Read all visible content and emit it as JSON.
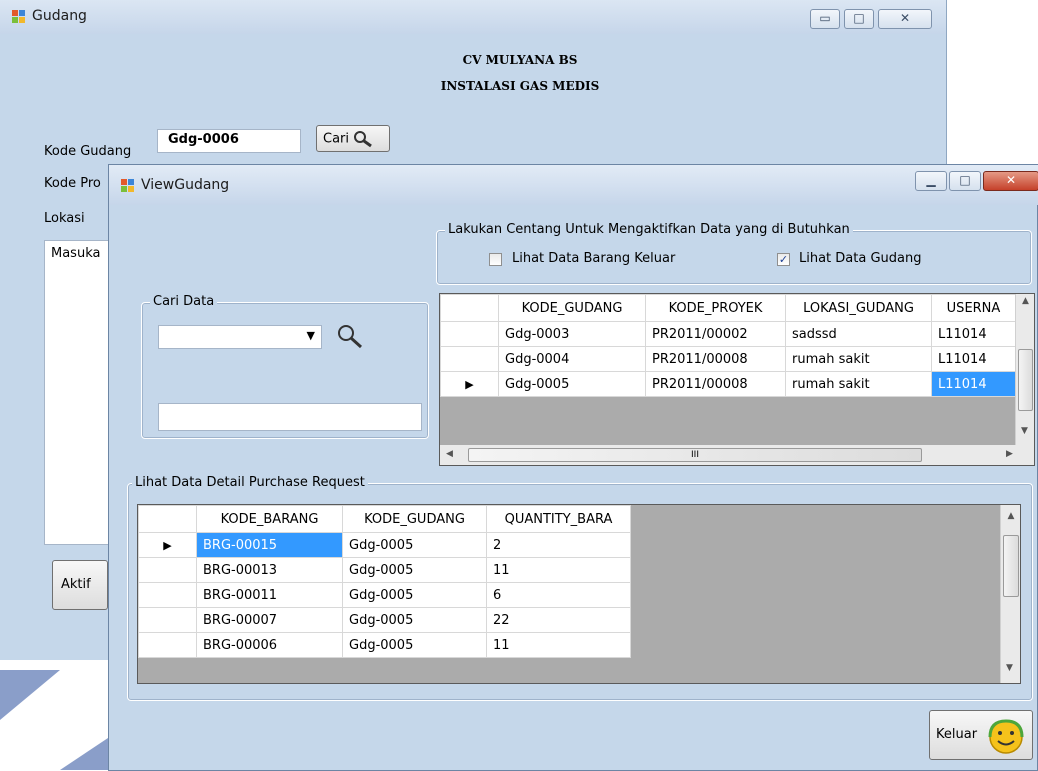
{
  "gudang_window": {
    "title": "Gudang",
    "company": "CV MULYANA BS",
    "subtitle": "INSTALASI GAS MEDIS",
    "kode_gudang_label": "Kode Gudang",
    "kode_gudang_value": "Gdg-0006",
    "cari_label": "Cari",
    "kode_proyek_label": "Kode Pro",
    "lokasi_label": "Lokasi",
    "lokasi_value": "Masuka",
    "aktif_label": "Aktif"
  },
  "view_window": {
    "title": "ViewGudang",
    "check_group_title": "Lakukan Centang Untuk Mengaktifkan Data yang di Butuhkan",
    "check_keluar_label": "Lihat Data Barang Keluar",
    "check_keluar_checked": false,
    "check_gudang_label": "Lihat Data Gudang",
    "check_gudang_checked": true,
    "cari_group_title": "Cari Data",
    "cari_text": "",
    "detail_group_title": "Lihat Data Detail Purchase Request",
    "keluar_label": "Keluar"
  },
  "gudang_grid": {
    "columns": [
      "KODE_GUDANG",
      "KODE_PROYEK",
      "LOKASI_GUDANG",
      "USERNA"
    ],
    "rows": [
      [
        "Gdg-0003",
        "PR2011/00002",
        "sadssd",
        "L11014"
      ],
      [
        "Gdg-0004",
        "PR2011/00008",
        "rumah sakit",
        "L11014"
      ],
      [
        "Gdg-0005",
        "PR2011/00008",
        "rumah sakit",
        "L11014"
      ]
    ],
    "current_row_marker": "▶",
    "hscroll_thumb_glyph": "III"
  },
  "detail_grid": {
    "columns": [
      "KODE_BARANG",
      "KODE_GUDANG",
      "QUANTITY_BARA"
    ],
    "rows": [
      [
        "BRG-00015",
        "Gdg-0005",
        "2"
      ],
      [
        "BRG-00013",
        "Gdg-0005",
        "11"
      ],
      [
        "BRG-00011",
        "Gdg-0005",
        "6"
      ],
      [
        "BRG-00007",
        "Gdg-0005",
        "22"
      ],
      [
        "BRG-00006",
        "Gdg-0005",
        "11"
      ]
    ],
    "current_row_marker": "▶"
  },
  "icons": {
    "app": "app-window-icon",
    "search": "magnifier-icon",
    "keluar": "smiley-exit-icon"
  },
  "colors": {
    "window_bg": "#c5d7ea",
    "selection": "#3399ff",
    "close_button": "#c5412a",
    "watermark_blue": "#2c4f9e",
    "watermark_orange": "#f08a1d"
  }
}
